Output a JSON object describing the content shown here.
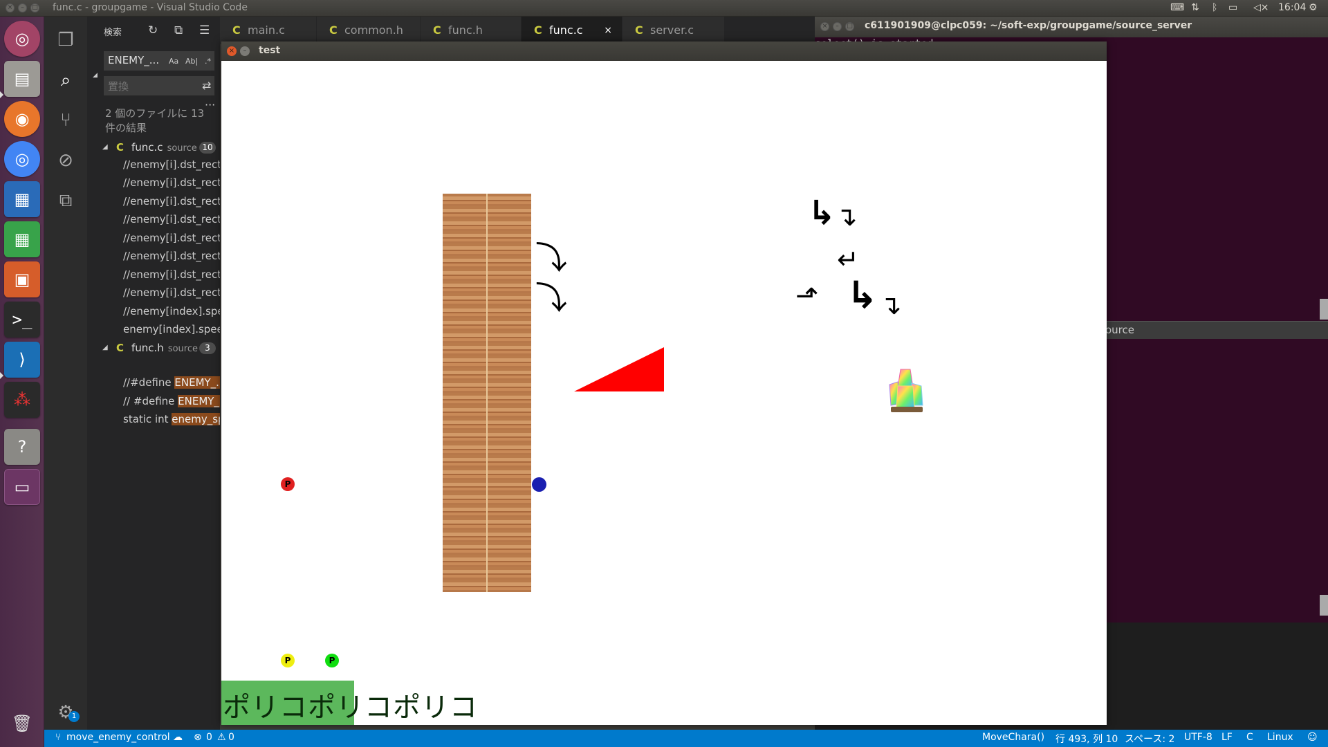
{
  "topbar": {
    "window_title": "func.c - groupgame - Visual Studio Code",
    "clock": "16:04",
    "tray_icons": [
      "keyboard-icon",
      "network-arrows-icon",
      "bluetooth-icon",
      "battery-icon",
      "volume-icon"
    ]
  },
  "launcher": {
    "apps": [
      "ubuntu-dash-icon",
      "files-icon",
      "firefox-icon",
      "chrome-icon",
      "writer-icon",
      "calc-icon",
      "impress-icon",
      "terminal-icon",
      "vscode-icon",
      "app-icon",
      "help-icon",
      "workspace-icon",
      "trash-icon"
    ]
  },
  "sidebar": {
    "title": "検索",
    "search_value": "ENEMY_...",
    "option_case": "Aa",
    "option_word": "Ab|",
    "option_regex": ".*",
    "replace_placeholder": "置換",
    "summary": "2 個のファイルに 13 件の結果",
    "groups": [
      {
        "icon": "C",
        "filename": "func.c",
        "folder": "source",
        "count": "10",
        "matches": [
          "//enemy[i].dst_rect...",
          "//enemy[i].dst_rect...",
          "//enemy[i].dst_rect...",
          "//enemy[i].dst_rect...",
          "//enemy[i].dst_rect...",
          "//enemy[i].dst_rect...",
          "//enemy[i].dst_rect...",
          "//enemy[i].dst_rect...",
          "//enemy[index].spe...",
          "enemy[index].spee..."
        ]
      },
      {
        "icon": "C",
        "filename": "func.h",
        "folder": "source",
        "count": "3",
        "matches": [
          {
            "pre": "//#define ",
            "hl": "ENEMY_..."
          },
          {
            "pre": "// #define ",
            "hl": "ENEMY_..."
          },
          {
            "pre": "static int ",
            "hl": "enemy_sp..."
          }
        ]
      }
    ]
  },
  "tabs": [
    {
      "icon": "C",
      "label": "main.c",
      "active": false
    },
    {
      "icon": "C",
      "label": "common.h",
      "active": false
    },
    {
      "icon": "C",
      "label": "func.h",
      "active": false
    },
    {
      "icon": "C",
      "label": "func.c",
      "active": true,
      "close": "×"
    },
    {
      "icon": "C",
      "label": "server.c",
      "active": false
    }
  ],
  "terminal": {
    "title": "c611901909@clpc059: ~/soft-exp/groupgame/source_server",
    "line1": "select() is started",
    "panel_label": "ource"
  },
  "test_window": {
    "title": "test",
    "close_glyph": "×",
    "min_glyph": "–",
    "player_tokens": [
      {
        "label": "P",
        "color": "#e02020"
      },
      {
        "label": "P",
        "color": "#eeee10"
      },
      {
        "label": "P",
        "color": "#10dd10"
      }
    ],
    "ground_text": "ポリコポリコポリコ"
  },
  "statusbar": {
    "branch": "move_enemy_control",
    "errors": "0",
    "warnings": "0",
    "function": "MoveChara()",
    "position": "行 493, 列 10",
    "spaces": "スペース: 2",
    "encoding": "UTF-8",
    "eol": "LF",
    "language": "C",
    "platform": "Linux",
    "settings_badge": "1"
  }
}
